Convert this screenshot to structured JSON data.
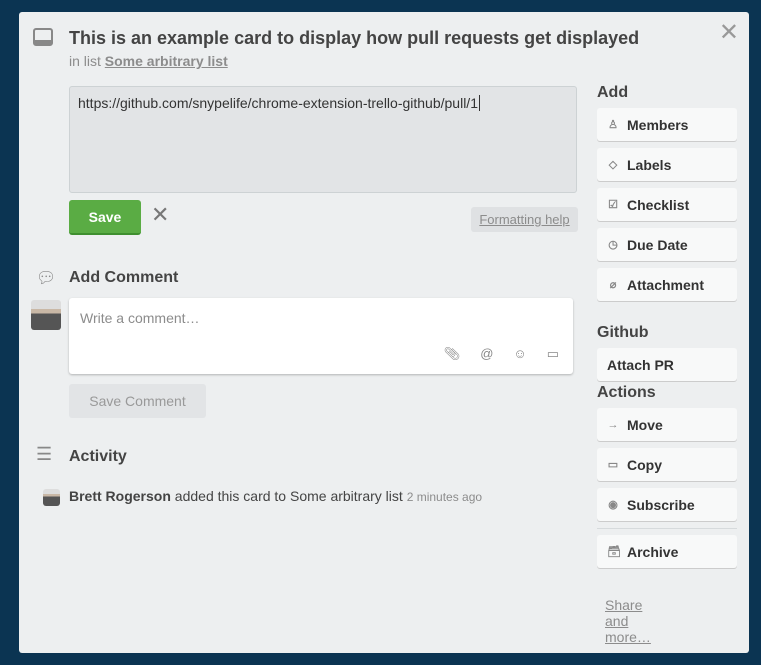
{
  "card": {
    "title": "This is an example card to display how pull requests get displayed",
    "in_list_prefix": "in list",
    "list_name": "Some arbitrary list"
  },
  "editor": {
    "value": "https://github.com/snypelife/chrome-extension-trello-github/pull/1",
    "save_label": "Save",
    "formatting_help": "Formatting help"
  },
  "comment": {
    "heading": "Add Comment",
    "placeholder": "Write a comment…",
    "save_label": "Save Comment",
    "icons": [
      "paperclip-icon",
      "at-icon",
      "emoji-icon",
      "card-icon"
    ]
  },
  "activity": {
    "heading": "Activity",
    "items": [
      {
        "user": "Brett Rogerson",
        "text": "added this card to Some arbitrary list",
        "time": "2 minutes ago"
      }
    ]
  },
  "sidebar": {
    "add": {
      "heading": "Add",
      "items": [
        {
          "label": "Members",
          "icon": "person-icon"
        },
        {
          "label": "Labels",
          "icon": "tag-icon"
        },
        {
          "label": "Checklist",
          "icon": "checkbox-icon"
        },
        {
          "label": "Due Date",
          "icon": "clock-icon"
        },
        {
          "label": "Attachment",
          "icon": "paperclip-icon"
        }
      ]
    },
    "github": {
      "heading": "Github",
      "items": [
        {
          "label": "Attach PR"
        }
      ]
    },
    "actions": {
      "heading": "Actions",
      "items": [
        {
          "label": "Move",
          "icon": "arrow-right-icon"
        },
        {
          "label": "Copy",
          "icon": "card-icon"
        },
        {
          "label": "Subscribe",
          "icon": "eye-icon"
        }
      ],
      "archive": {
        "label": "Archive",
        "icon": "archive-icon"
      }
    },
    "share": "Share and more…"
  },
  "colors": {
    "background": "#0b3452",
    "save_green": "#5aac44"
  }
}
